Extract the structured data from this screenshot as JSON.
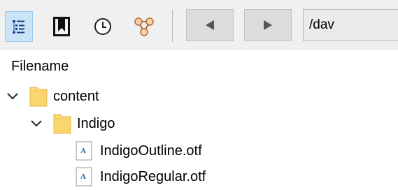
{
  "toolbar": {
    "buttons": [
      {
        "icon": "tree-view-icon",
        "active": true
      },
      {
        "icon": "bookmark-icon",
        "active": false
      },
      {
        "icon": "history-clock-icon",
        "active": false
      },
      {
        "icon": "network-share-icon",
        "active": false
      }
    ],
    "back_icon": "triangle-left-icon",
    "forward_icon": "triangle-right-icon",
    "path_value": "/dav"
  },
  "columns": {
    "filename": "Filename"
  },
  "tree": [
    {
      "label": "content",
      "type": "folder",
      "expanded": true,
      "level": 0
    },
    {
      "label": "Indigo",
      "type": "folder",
      "expanded": true,
      "level": 1
    },
    {
      "label": "IndigoOutline.otf",
      "type": "file",
      "level": 2
    },
    {
      "label": "IndigoRegular.otf",
      "type": "file",
      "level": 2
    }
  ],
  "colors": {
    "toolbar_bg": "#f0f0f0",
    "active_button": "#cce4f7",
    "folder": "#fbd66e",
    "file_accent": "#2b5fb6"
  }
}
